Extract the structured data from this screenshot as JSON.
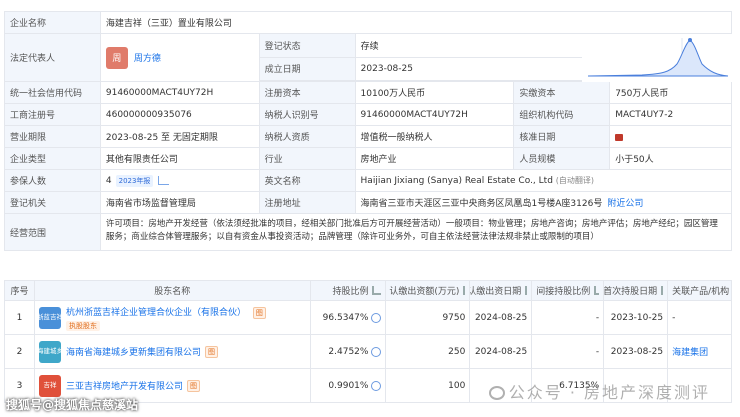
{
  "company": {
    "name_label": "企业名称",
    "name": "海建吉祥（三亚）置业有限公司",
    "legal_rep_label": "法定代表人",
    "legal_rep_avatar": "周",
    "legal_rep": "周方德",
    "status_label": "登记状态",
    "status": "存续",
    "founded_label": "成立日期",
    "founded": "2023-08-25",
    "credit_code_label": "统一社会信用代码",
    "credit_code": "91460000MACT4UY72H",
    "reg_capital_label": "注册资本",
    "reg_capital": "10100万人民币",
    "paid_capital_label": "实缴资本",
    "paid_capital": "750万人民币",
    "biz_reg_no_label": "工商注册号",
    "biz_reg_no": "460000000935076",
    "taxpayer_id_label": "纳税人识别号",
    "taxpayer_id": "91460000MACT4UY72H",
    "org_code_label": "组织机构代码",
    "org_code": "MACT4UY7-2",
    "term_label": "营业期限",
    "term": "2023-08-25 至 无固定期限",
    "taxpayer_type_label": "纳税人资质",
    "taxpayer_type": "增值税一般纳税人",
    "approval_date_label": "核准日期",
    "type_label": "企业类型",
    "type": "其他有限责任公司",
    "industry_label": "行业",
    "industry": "房地产业",
    "staff_size_label": "人员规模",
    "staff_size": "小于50人",
    "insured_label": "参保人数",
    "insured": "4",
    "insured_tag": "2023年报",
    "en_name_label": "英文名称",
    "en_name": "Haijian Jixiang (Sanya) Real Estate Co., Ltd",
    "en_name_note": "(自动翻译)",
    "reg_authority_label": "登记机关",
    "reg_authority": "海南省市场监督管理局",
    "address_label": "注册地址",
    "address": "海南省三亚市天涯区三亚中央商务区凤凰岛1号楼A座3126号",
    "address_link": "附近公司",
    "scope_label": "经营范围",
    "scope": "许可项目：房地产开发经营（依法须经批准的项目，经相关部门批准后方可开展经营活动）一般项目：物业管理；房地产咨询；房地产评估；房地产经纪；园区管理服务；商业综合体管理服务；以自有资金从事投资活动；品牌管理（除许可业务外，可自主依法经营法律法规非禁止或限制的项目）"
  },
  "shareholders": {
    "headers": [
      "序号",
      "股东名称",
      "持股比例",
      "认缴出资额(万元)",
      "认缴出资日期",
      "间接持股比例",
      "首次持股日期",
      "关联产品/机构"
    ],
    "rows": [
      {
        "no": "1",
        "logo": "浙蓝吉祥",
        "logo_color": "#4a90d9",
        "name": "杭州浙蓝吉祥企业管理合伙企业（有限合伙）",
        "tag": "执股股东",
        "ratio": "96.5347%",
        "amount": "9750",
        "date": "2024-08-25",
        "indirect": "-",
        "first_date": "2023-10-25",
        "related": "-"
      },
      {
        "no": "2",
        "logo": "海建城乡",
        "logo_color": "#3fa7c9",
        "name": "海南省海建城乡更新集团有限公司",
        "tag": "",
        "ratio": "2.4752%",
        "amount": "250",
        "date": "2024-08-25",
        "indirect": "-",
        "first_date": "2023-08-25",
        "related": "海建集团"
      },
      {
        "no": "3",
        "logo": "吉祥",
        "logo_color": "#e0503a",
        "name": "三亚吉祥房地产开发有限公司",
        "tag": "",
        "ratio": "0.9901%",
        "amount": "100",
        "date": "",
        "indirect": "6.7135%",
        "first_date": "",
        "related": ""
      }
    ]
  },
  "watermark_left": "搜狐号@搜狐焦点慈溪站",
  "watermark_right": "公众号 · 房地产深度测评"
}
